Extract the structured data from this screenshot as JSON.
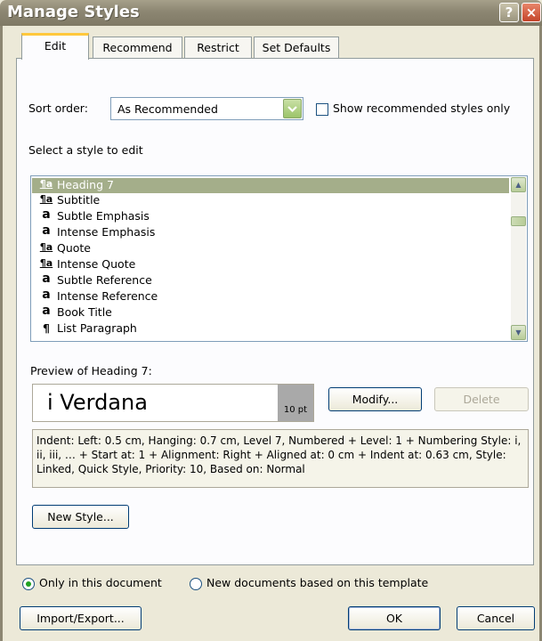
{
  "window": {
    "title": "Manage Styles",
    "help_icon": "?",
    "close_icon": "×"
  },
  "tabs": [
    {
      "label": "Edit",
      "active": true
    },
    {
      "label": "Recommend",
      "active": false
    },
    {
      "label": "Restrict",
      "active": false
    },
    {
      "label": "Set Defaults",
      "active": false
    }
  ],
  "sort_order": {
    "label": "Sort order:",
    "value": "As Recommended"
  },
  "show_recommended": {
    "label": "Show recommended styles only",
    "checked": false
  },
  "select_label": "Select a style to edit",
  "style_list": [
    {
      "icon": "¶a",
      "name": "Heading 7",
      "type": "paragraph",
      "selected": true
    },
    {
      "icon": "¶a",
      "name": "Subtitle",
      "type": "paragraph",
      "selected": false
    },
    {
      "icon": "a",
      "name": "Subtle Emphasis",
      "type": "character",
      "selected": false
    },
    {
      "icon": "a",
      "name": "Intense Emphasis",
      "type": "character",
      "selected": false
    },
    {
      "icon": "¶a",
      "name": "Quote",
      "type": "paragraph",
      "selected": false
    },
    {
      "icon": "¶a",
      "name": "Intense Quote",
      "type": "paragraph",
      "selected": false
    },
    {
      "icon": "a",
      "name": "Subtle Reference",
      "type": "character",
      "selected": false
    },
    {
      "icon": "a",
      "name": "Intense Reference",
      "type": "character",
      "selected": false
    },
    {
      "icon": "a",
      "name": "Book Title",
      "type": "character",
      "selected": false
    },
    {
      "icon": "¶",
      "name": "List Paragraph",
      "type": "paragraph-only",
      "selected": false
    }
  ],
  "preview": {
    "label": "Preview of Heading 7:",
    "sample": "i  Verdana",
    "size": "10 pt"
  },
  "buttons": {
    "modify": "Modify...",
    "delete": "Delete",
    "new_style": "New Style...",
    "import_export": "Import/Export...",
    "ok": "OK",
    "cancel": "Cancel"
  },
  "description": "Indent: Left:  0.5 cm, Hanging:  0.7 cm, Level 7, Numbered + Level: 1 + Numbering Style: i, ii, iii, … + Start at: 1 + Alignment: Right + Aligned at:  0 cm + Indent at:  0.63 cm, Style: Linked, Quick Style, Priority: 10, Based on: Normal",
  "scope": {
    "only_this_document": {
      "label": "Only in this document",
      "selected": true
    },
    "new_documents": {
      "label": "New documents based on this template",
      "selected": false
    }
  },
  "colors": {
    "title_bar": "#8c8672",
    "selection": "#a4ae8a",
    "tab_highlight": "#ffc83c",
    "dialog_bg": "#ece9d8"
  }
}
